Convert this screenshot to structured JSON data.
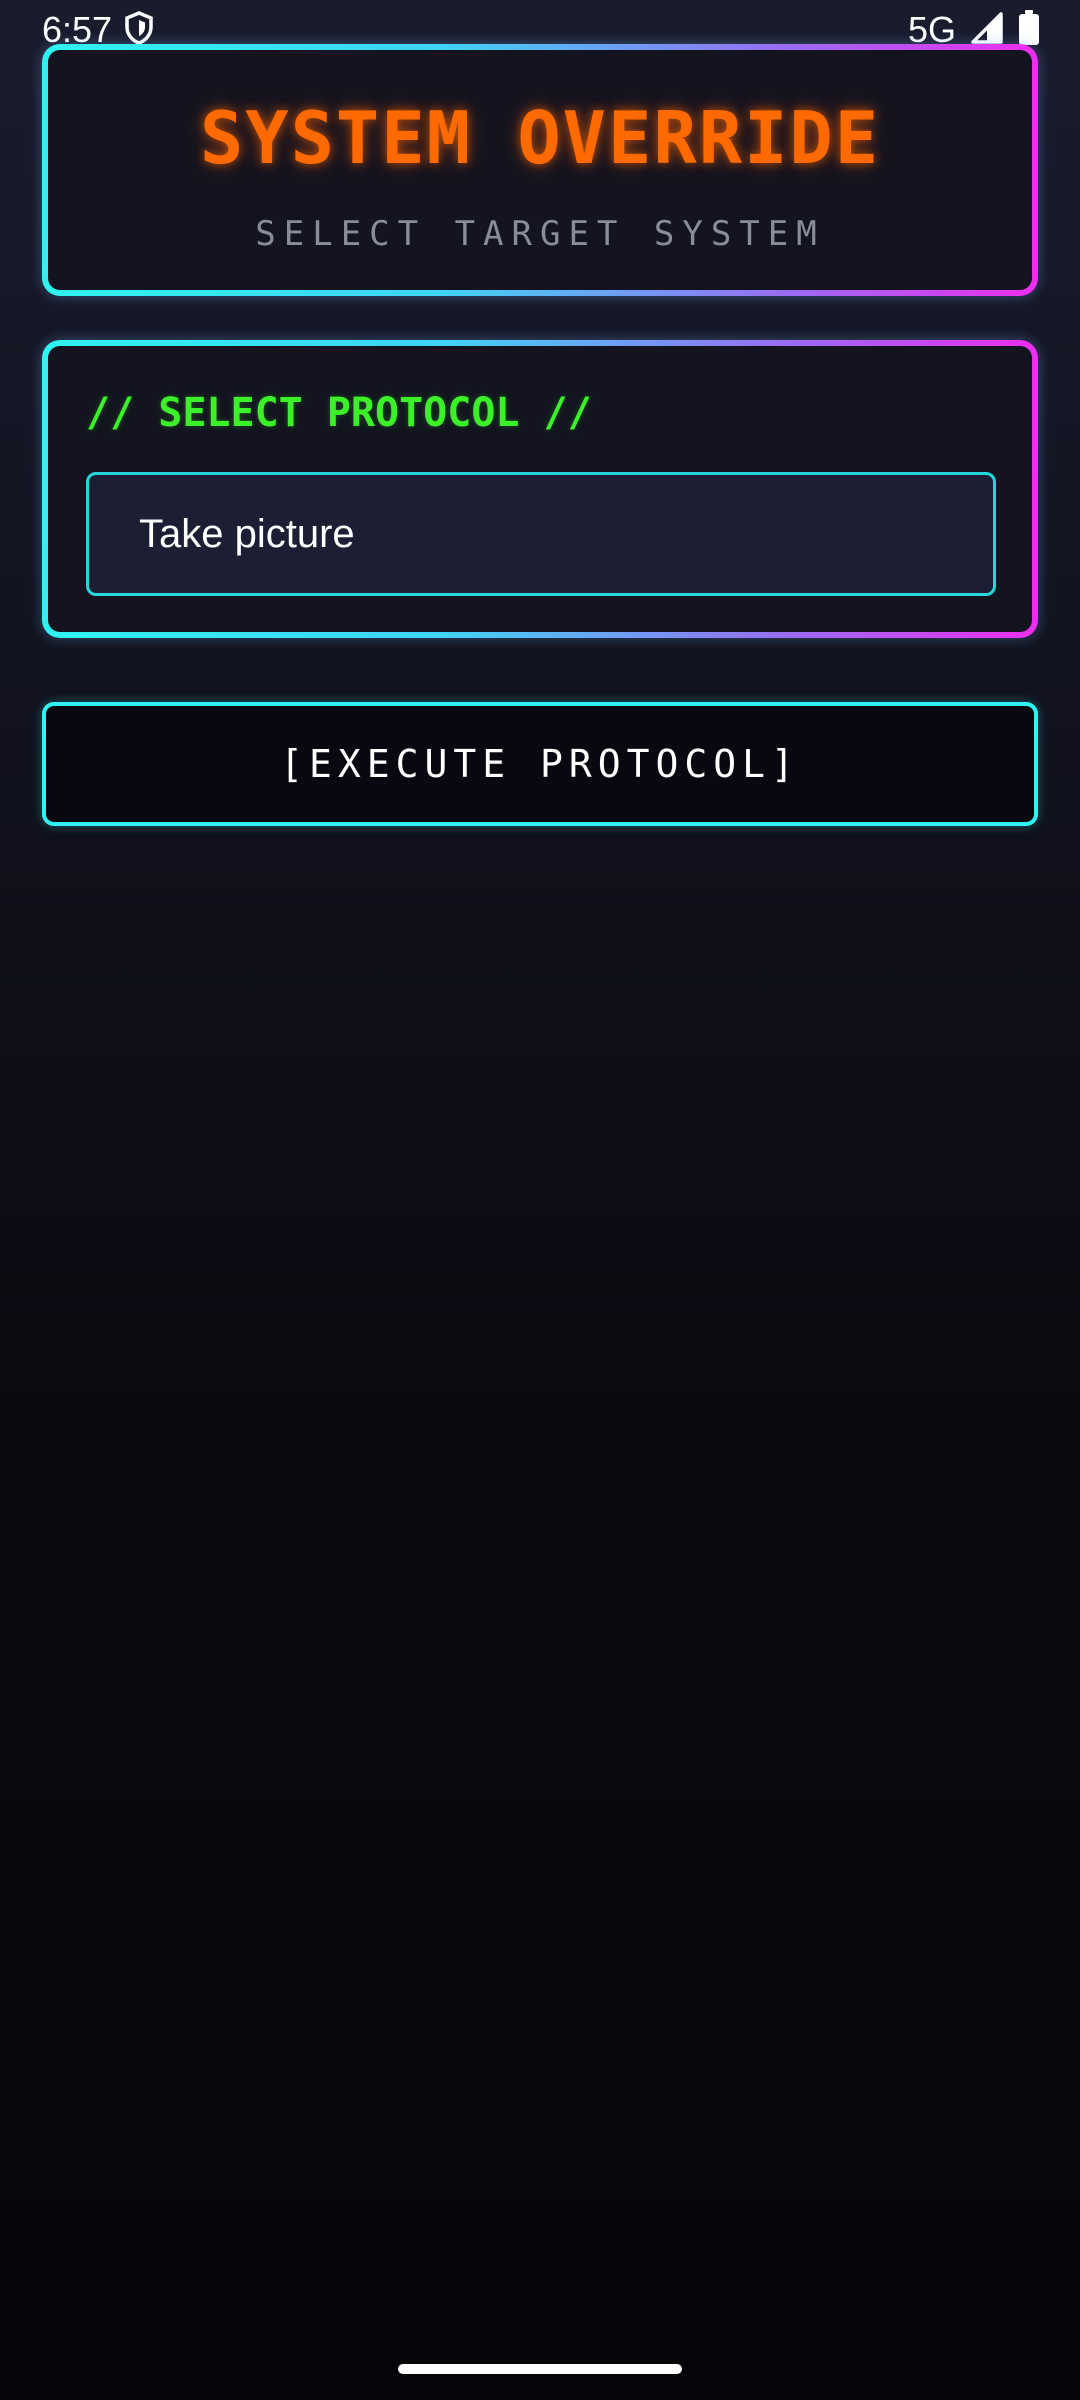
{
  "status_bar": {
    "time": "6:57",
    "network": "5G",
    "icons": [
      "shield-icon",
      "signal-icon",
      "battery-icon"
    ]
  },
  "header": {
    "title": "SYSTEM OVERRIDE",
    "subtitle": "SELECT TARGET SYSTEM"
  },
  "protocol": {
    "heading": "// SELECT PROTOCOL //",
    "selected_value": "Take picture"
  },
  "execute": {
    "label": "[EXECUTE PROTOCOL]"
  },
  "colors": {
    "accent_cyan": "#2ff3f0",
    "accent_magenta": "#ee2dee",
    "title_orange": "#ff6a00",
    "heading_green": "#3cf02a"
  }
}
